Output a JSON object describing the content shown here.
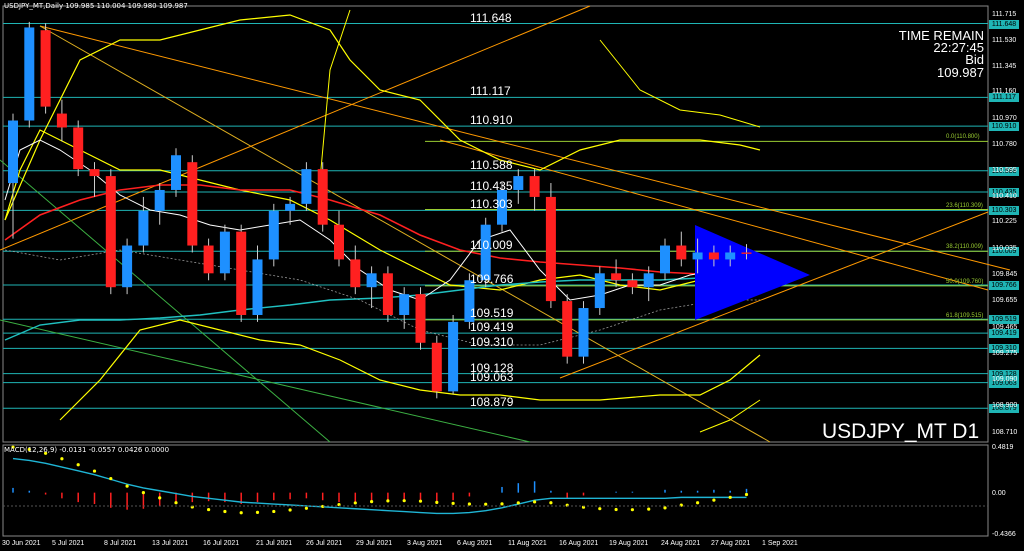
{
  "header": {
    "ohlc_text": "USDJPY_MT,Daily  109.985 110.004 109.980 109.987",
    "macd_text": "MACD(12,26,9) -0.0131 -0.0557 0.0426 0.0000"
  },
  "time_remain": {
    "label": "TIME REMAIN",
    "value": "22:27:45",
    "bid_label": "Bid",
    "bid_value": "109.987"
  },
  "symbol_label": "USDJPY_MT D1",
  "horizontal_levels": [
    {
      "label": "111.648",
      "price": 111.648
    },
    {
      "label": "111.117",
      "price": 111.117
    },
    {
      "label": "110.910",
      "price": 110.91
    },
    {
      "label": "110.588",
      "price": 110.588
    },
    {
      "label": "110.435",
      "price": 110.435
    },
    {
      "label": "110.303",
      "price": 110.303
    },
    {
      "label": "110.009",
      "price": 110.009
    },
    {
      "label": "109.766",
      "price": 109.766
    },
    {
      "label": "109.519",
      "price": 109.519
    },
    {
      "label": "109.419",
      "price": 109.419
    },
    {
      "label": "109.310",
      "price": 109.31
    },
    {
      "label": "109.128",
      "price": 109.128
    },
    {
      "label": "109.063",
      "price": 109.063
    },
    {
      "label": "108.879",
      "price": 108.879
    }
  ],
  "fib_levels": [
    {
      "label": "0.0(110.800)",
      "price": 110.8
    },
    {
      "label": "23.6(110.309)",
      "price": 110.309
    },
    {
      "label": "38.2(110.009)",
      "price": 110.009
    },
    {
      "label": "50.0(109.760)",
      "price": 109.76
    },
    {
      "label": "61.8(109.515)",
      "price": 109.515
    }
  ],
  "price_axis_labels": [
    "111.715",
    "111.530",
    "111.345",
    "111.160",
    "110.970",
    "110.780",
    "110.595",
    "110.410",
    "110.225",
    "110.035",
    "109.845",
    "109.655",
    "109.465",
    "109.275",
    "109.090",
    "108.900",
    "108.710"
  ],
  "price_axis_range": [
    108.65,
    111.76
  ],
  "right_tags": [
    "111.648",
    "111.117",
    "110.910",
    "110.588",
    "110.435",
    "110.303",
    "110.009",
    "109.766",
    "109.519",
    "109.419",
    "109.310",
    "109.128",
    "109.063",
    "108.879"
  ],
  "macd_axis_labels": [
    "0.4819",
    "0.00",
    "-0.4366"
  ],
  "date_labels": [
    "30 Jun 2021",
    "5 Jul 2021",
    "8 Jul 2021",
    "13 Jul 2021",
    "16 Jul 2021",
    "21 Jul 2021",
    "26 Jul 2021",
    "29 Jul 2021",
    "3 Aug 2021",
    "6 Aug 2021",
    "11 Aug 2021",
    "16 Aug 2021",
    "19 Aug 2021",
    "24 Aug 2021",
    "27 Aug 2021",
    "1 Sep 2021"
  ],
  "colors": {
    "bull": "#1e90ff",
    "bear": "#ff2020",
    "level": "#1fb5b5",
    "fib": "#9acd32",
    "triangle": "#0000ff",
    "ma": "#ff2020",
    "bands": "#ffff00",
    "trend": "#ff9900"
  },
  "chart_data": {
    "type": "candlestick",
    "candles": [
      {
        "o": 110.5,
        "h": 111.0,
        "l": 110.1,
        "c": 110.95
      },
      {
        "o": 110.95,
        "h": 111.66,
        "l": 110.9,
        "c": 111.62
      },
      {
        "o": 111.6,
        "h": 111.65,
        "l": 111.0,
        "c": 111.05
      },
      {
        "o": 111.0,
        "h": 111.1,
        "l": 110.8,
        "c": 110.9
      },
      {
        "o": 110.9,
        "h": 110.95,
        "l": 110.55,
        "c": 110.6
      },
      {
        "o": 110.6,
        "h": 110.65,
        "l": 110.4,
        "c": 110.55
      },
      {
        "o": 110.55,
        "h": 110.6,
        "l": 109.7,
        "c": 109.75
      },
      {
        "o": 109.75,
        "h": 110.1,
        "l": 109.7,
        "c": 110.05
      },
      {
        "o": 110.05,
        "h": 110.4,
        "l": 110.0,
        "c": 110.3
      },
      {
        "o": 110.3,
        "h": 110.5,
        "l": 110.2,
        "c": 110.45
      },
      {
        "o": 110.45,
        "h": 110.75,
        "l": 110.4,
        "c": 110.7
      },
      {
        "o": 110.65,
        "h": 110.7,
        "l": 110.0,
        "c": 110.05
      },
      {
        "o": 110.05,
        "h": 110.1,
        "l": 109.8,
        "c": 109.85
      },
      {
        "o": 109.85,
        "h": 110.2,
        "l": 109.8,
        "c": 110.15
      },
      {
        "o": 110.15,
        "h": 110.2,
        "l": 109.5,
        "c": 109.55
      },
      {
        "o": 109.55,
        "h": 110.05,
        "l": 109.5,
        "c": 109.95
      },
      {
        "o": 109.95,
        "h": 110.35,
        "l": 109.9,
        "c": 110.3
      },
      {
        "o": 110.3,
        "h": 110.4,
        "l": 110.2,
        "c": 110.35
      },
      {
        "o": 110.35,
        "h": 110.65,
        "l": 110.3,
        "c": 110.6
      },
      {
        "o": 110.6,
        "h": 110.65,
        "l": 110.15,
        "c": 110.2
      },
      {
        "o": 110.2,
        "h": 110.3,
        "l": 109.9,
        "c": 109.95
      },
      {
        "o": 109.95,
        "h": 110.05,
        "l": 109.7,
        "c": 109.75
      },
      {
        "o": 109.75,
        "h": 109.9,
        "l": 109.6,
        "c": 109.85
      },
      {
        "o": 109.85,
        "h": 109.9,
        "l": 109.5,
        "c": 109.55
      },
      {
        "o": 109.55,
        "h": 109.75,
        "l": 109.45,
        "c": 109.7
      },
      {
        "o": 109.7,
        "h": 109.75,
        "l": 109.3,
        "c": 109.35
      },
      {
        "o": 109.35,
        "h": 109.4,
        "l": 108.95,
        "c": 109.0
      },
      {
        "o": 109.0,
        "h": 109.55,
        "l": 108.98,
        "c": 109.5
      },
      {
        "o": 109.5,
        "h": 109.85,
        "l": 109.45,
        "c": 109.8
      },
      {
        "o": 109.8,
        "h": 110.25,
        "l": 109.75,
        "c": 110.2
      },
      {
        "o": 110.2,
        "h": 110.5,
        "l": 110.15,
        "c": 110.45
      },
      {
        "o": 110.45,
        "h": 110.6,
        "l": 110.35,
        "c": 110.55
      },
      {
        "o": 110.55,
        "h": 110.6,
        "l": 110.3,
        "c": 110.4
      },
      {
        "o": 110.4,
        "h": 110.5,
        "l": 109.6,
        "c": 109.65
      },
      {
        "o": 109.65,
        "h": 109.7,
        "l": 109.2,
        "c": 109.25
      },
      {
        "o": 109.25,
        "h": 109.65,
        "l": 109.2,
        "c": 109.6
      },
      {
        "o": 109.6,
        "h": 109.9,
        "l": 109.55,
        "c": 109.85
      },
      {
        "o": 109.85,
        "h": 109.95,
        "l": 109.75,
        "c": 109.8
      },
      {
        "o": 109.8,
        "h": 109.85,
        "l": 109.7,
        "c": 109.75
      },
      {
        "o": 109.75,
        "h": 109.9,
        "l": 109.65,
        "c": 109.85
      },
      {
        "o": 109.85,
        "h": 110.1,
        "l": 109.8,
        "c": 110.05
      },
      {
        "o": 110.05,
        "h": 110.15,
        "l": 109.9,
        "c": 109.95
      },
      {
        "o": 109.95,
        "h": 110.1,
        "l": 109.85,
        "c": 110.0
      },
      {
        "o": 110.0,
        "h": 110.05,
        "l": 109.9,
        "c": 109.95
      },
      {
        "o": 109.95,
        "h": 110.05,
        "l": 109.9,
        "c": 110.0
      },
      {
        "o": 110.0,
        "h": 110.06,
        "l": 109.95,
        "c": 109.99
      }
    ],
    "macd_histogram": [
      0.05,
      0.02,
      -0.02,
      -0.06,
      -0.1,
      -0.12,
      -0.16,
      -0.18,
      -0.17,
      -0.14,
      -0.12,
      -0.1,
      -0.09,
      -0.1,
      -0.12,
      -0.1,
      -0.08,
      -0.07,
      -0.06,
      -0.08,
      -0.1,
      -0.11,
      -0.1,
      -0.09,
      -0.08,
      -0.1,
      -0.12,
      -0.08,
      -0.04,
      0.0,
      0.06,
      0.1,
      0.12,
      0.02,
      -0.06,
      -0.03,
      0.0,
      0.01,
      0.01,
      0.0,
      0.03,
      0.02,
      0.02,
      0.03,
      0.02,
      0.04
    ],
    "macd_signal": [
      0.36,
      0.34,
      0.31,
      0.27,
      0.23,
      0.19,
      0.14,
      0.09,
      0.05,
      0.02,
      -0.01,
      -0.04,
      -0.06,
      -0.08,
      -0.1,
      -0.11,
      -0.12,
      -0.13,
      -0.14,
      -0.15,
      -0.16,
      -0.17,
      -0.18,
      -0.19,
      -0.2,
      -0.21,
      -0.22,
      -0.22,
      -0.21,
      -0.19,
      -0.16,
      -0.12,
      -0.08,
      -0.06,
      -0.06,
      -0.06,
      -0.06,
      -0.06,
      -0.06,
      -0.06,
      -0.06,
      -0.05,
      -0.05,
      -0.05,
      -0.05,
      -0.05
    ],
    "macd_range": [
      -0.4366,
      0.4819
    ]
  }
}
